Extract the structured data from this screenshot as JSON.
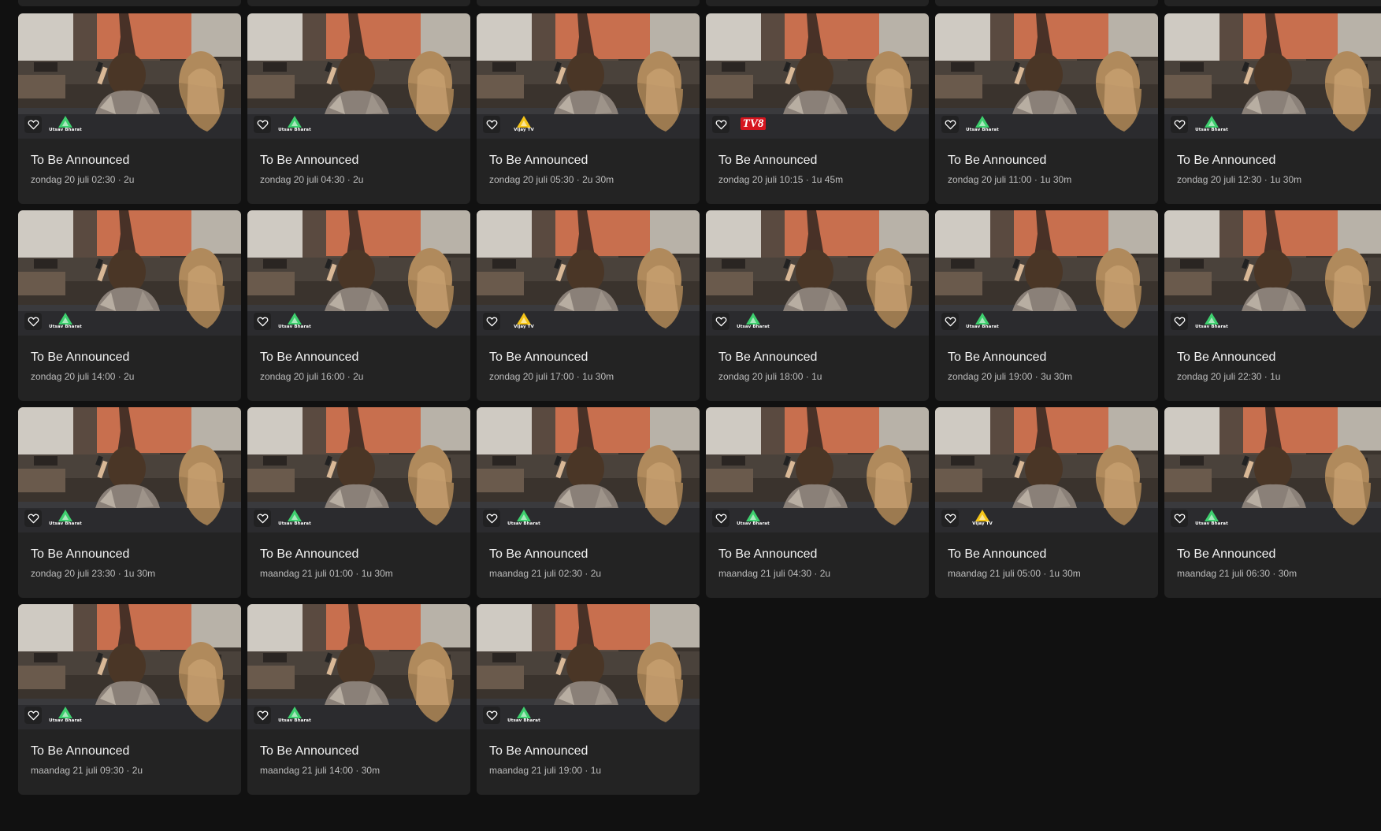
{
  "colors": {
    "background": "#111111",
    "card": "#232323",
    "title": "#f2f2f2",
    "meta": "#bdbdbd",
    "channel_utsav": "#3ecf6e",
    "channel_vijay": "#f5c518",
    "channel_tv8": "#d6141e"
  },
  "icons": {
    "favorite": "heart-outline-icon"
  },
  "cards": [
    {
      "title": "To Be Announced",
      "meta": "zondag 20 juli 02:30 · 2u",
      "channel": "Utsav Bharat",
      "logo": "utsav"
    },
    {
      "title": "To Be Announced",
      "meta": "zondag 20 juli 04:30 · 2u",
      "channel": "Utsav Bharat",
      "logo": "utsav"
    },
    {
      "title": "To Be Announced",
      "meta": "zondag 20 juli 05:30 · 2u 30m",
      "channel": "Vijay TV",
      "logo": "vijay"
    },
    {
      "title": "To Be Announced",
      "meta": "zondag 20 juli 10:15 · 1u 45m",
      "channel": "TV8",
      "logo": "tv8"
    },
    {
      "title": "To Be Announced",
      "meta": "zondag 20 juli 11:00 · 1u 30m",
      "channel": "Utsav Bharat",
      "logo": "utsav"
    },
    {
      "title": "To Be Announced",
      "meta": "zondag 20 juli 12:30 · 1u 30m",
      "channel": "Utsav Bharat",
      "logo": "utsav"
    },
    {
      "title": "To Be Announced",
      "meta": "zondag 20 juli 14:00 · 2u",
      "channel": "Utsav Bharat",
      "logo": "utsav"
    },
    {
      "title": "To Be Announced",
      "meta": "zondag 20 juli 16:00 · 2u",
      "channel": "Utsav Bharat",
      "logo": "utsav"
    },
    {
      "title": "To Be Announced",
      "meta": "zondag 20 juli 17:00 · 1u 30m",
      "channel": "Vijay TV",
      "logo": "vijay"
    },
    {
      "title": "To Be Announced",
      "meta": "zondag 20 juli 18:00 · 1u",
      "channel": "Utsav Bharat",
      "logo": "utsav"
    },
    {
      "title": "To Be Announced",
      "meta": "zondag 20 juli 19:00 · 3u 30m",
      "channel": "Utsav Bharat",
      "logo": "utsav"
    },
    {
      "title": "To Be Announced",
      "meta": "zondag 20 juli 22:30 · 1u",
      "channel": "Utsav Bharat",
      "logo": "utsav"
    },
    {
      "title": "To Be Announced",
      "meta": "zondag 20 juli 23:30 · 1u 30m",
      "channel": "Utsav Bharat",
      "logo": "utsav"
    },
    {
      "title": "To Be Announced",
      "meta": "maandag 21 juli 01:00 · 1u 30m",
      "channel": "Utsav Bharat",
      "logo": "utsav"
    },
    {
      "title": "To Be Announced",
      "meta": "maandag 21 juli 02:30 · 2u",
      "channel": "Utsav Bharat",
      "logo": "utsav"
    },
    {
      "title": "To Be Announced",
      "meta": "maandag 21 juli 04:30 · 2u",
      "channel": "Utsav Bharat",
      "logo": "utsav"
    },
    {
      "title": "To Be Announced",
      "meta": "maandag 21 juli 05:00 · 1u 30m",
      "channel": "Vijay TV",
      "logo": "vijay"
    },
    {
      "title": "To Be Announced",
      "meta": "maandag 21 juli 06:30 · 30m",
      "channel": "Utsav Bharat",
      "logo": "utsav"
    },
    {
      "title": "To Be Announced",
      "meta": "maandag 21 juli 09:30 · 2u",
      "channel": "Utsav Bharat",
      "logo": "utsav"
    },
    {
      "title": "To Be Announced",
      "meta": "maandag 21 juli 14:00 · 30m",
      "channel": "Utsav Bharat",
      "logo": "utsav"
    },
    {
      "title": "To Be Announced",
      "meta": "maandag 21 juli 19:00 · 1u",
      "channel": "Utsav Bharat",
      "logo": "utsav"
    }
  ]
}
